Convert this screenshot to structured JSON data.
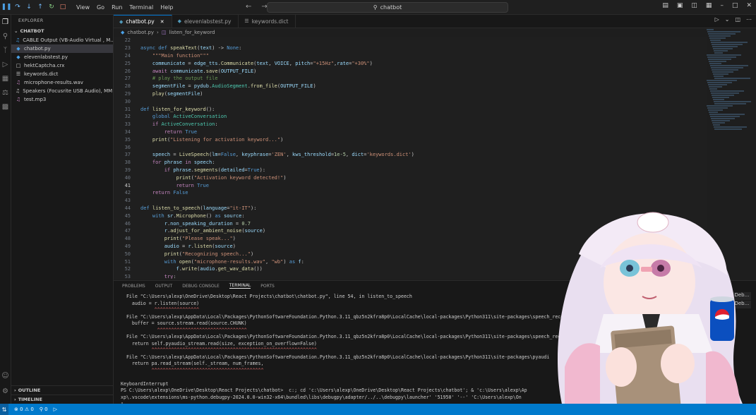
{
  "titlebar": {
    "menu": [
      "View",
      "Go",
      "Run",
      "Terminal",
      "Help"
    ],
    "search": "chatbot"
  },
  "sidebar": {
    "title": "EXPLORER",
    "section": "CHATBOT",
    "files": [
      {
        "name": "CABLE Output (VB-Audio Virtual , M...",
        "icon": "audio-file-icon"
      },
      {
        "name": "chatbot.py",
        "icon": "python-file-icon",
        "active": true
      },
      {
        "name": "elevenlabstest.py",
        "icon": "python-file-icon"
      },
      {
        "name": "hektCaptcha.crx",
        "icon": "generic-file-icon"
      },
      {
        "name": "keywords.dict",
        "icon": "generic-file-icon"
      },
      {
        "name": "microphone-results.wav",
        "icon": "audio-file-icon"
      },
      {
        "name": "Speakers (Focusrite USB Audio), MM...",
        "icon": "audio-file-icon"
      },
      {
        "name": "test.mp3",
        "icon": "audio-file-icon"
      }
    ],
    "outline": "OUTLINE",
    "timeline": "TIMELINE"
  },
  "tabs": [
    {
      "label": "chatbot.py",
      "active": true
    },
    {
      "label": "elevenlabstest.py"
    },
    {
      "label": "keywords.dict"
    }
  ],
  "breadcrumb": {
    "file": "chatbot.py",
    "symbol": "listen_for_keyword"
  },
  "editor": {
    "lines": [
      {
        "n": "22",
        "text": ""
      },
      {
        "n": "23",
        "text": "async def speakText(text) -> None:"
      },
      {
        "n": "24",
        "text": "    \"\"\"Main function\"\"\""
      },
      {
        "n": "25",
        "text": "    communicate = edge_tts.Communicate(text, VOICE, pitch=\"+15Hz\",rate=\"+30%\")"
      },
      {
        "n": "26",
        "text": "    await communicate.save(OUTPUT_FILE)"
      },
      {
        "n": "27",
        "text": "    # play the output file"
      },
      {
        "n": "28",
        "text": "    segmentFile = pydub.AudioSegment.from_file(OUTPUT_FILE)"
      },
      {
        "n": "29",
        "text": "    play(segmentFile)"
      },
      {
        "n": "30",
        "text": ""
      },
      {
        "n": "31",
        "text": "def listen_for_keyword():"
      },
      {
        "n": "32",
        "text": "    global ActiveConversation"
      },
      {
        "n": "33",
        "text": "    if ActiveConversation:"
      },
      {
        "n": "34",
        "text": "        return True"
      },
      {
        "n": "35",
        "text": "    print(\"Listening for activation keyword...\")"
      },
      {
        "n": "36",
        "text": ""
      },
      {
        "n": "37",
        "text": "    speech = LiveSpeech(lm=False, keyphrase='ZEN', kws_threshold=1e-5, dict='keywords.dict')"
      },
      {
        "n": "38",
        "text": "    for phrase in speech:"
      },
      {
        "n": "39",
        "text": "        if phrase.segments(detailed=True):"
      },
      {
        "n": "40",
        "text": "            print(\"Activation keyword detected!\")"
      },
      {
        "n": "41",
        "text": "            return True",
        "current": true
      },
      {
        "n": "42",
        "text": "    return False"
      },
      {
        "n": "43",
        "text": ""
      },
      {
        "n": "44",
        "text": "def listen_to_speech(language=\"it-IT\"):"
      },
      {
        "n": "45",
        "text": "    with sr.Microphone() as source:"
      },
      {
        "n": "46",
        "text": "        r.non_speaking_duration = 0.7"
      },
      {
        "n": "47",
        "text": "        r.adjust_for_ambient_noise(source)"
      },
      {
        "n": "48",
        "text": "        print(\"Please speak...\")"
      },
      {
        "n": "49",
        "text": "        audio = r.listen(source)"
      },
      {
        "n": "50",
        "text": "        print(\"Recognizing speech...\")"
      },
      {
        "n": "51",
        "text": "        with open(\"microphone-results.wav\", \"wb\") as f:"
      },
      {
        "n": "52",
        "text": "            f.write(audio.get_wav_data())"
      },
      {
        "n": "53",
        "text": "        try:"
      }
    ]
  },
  "panel": {
    "tabs": [
      "PROBLEMS",
      "OUTPUT",
      "DEBUG CONSOLE",
      "TERMINAL",
      "PORTS"
    ],
    "active_tab": "TERMINAL",
    "terminal": [
      "  File \"C:\\Users\\alexp\\OneDrive\\Desktop\\React Projects\\chatbot\\chatbot.py\", line 54, in listen_to_speech",
      "    audio = r.listen(source)",
      "            ^^^^^^^^^^^^^^^^",
      "  File \"C:\\Users\\alexp\\AppData\\Local\\Packages\\PythonSoftwareFoundation.Python.3.11_qbz5n2kfra8p0\\LocalCache\\local-packages\\Python311\\site-packages\\speech_recog",
      "    buffer = source.stream.read(source.CHUNK)",
      "             ^^^^^^^^^^^^^^^^^^^^^^^^^^^^^^^^",
      "  File \"C:\\Users\\alexp\\AppData\\Local\\Packages\\PythonSoftwareFoundation.Python.3.11_qbz5n2kfra8p0\\LocalCache\\local-packages\\Python311\\site-packages\\speech_reco",
      "    return self.pyaudio_stream.read(size, exception_on_overflow=False)",
      "           ^^^^^^^^^^^^^^^^^^^^^^^^^^^^^^^^^^^^^^^^^^^^^^^^^^^^^^^^^^^",
      "  File \"C:\\Users\\alexp\\AppData\\Local\\Packages\\PythonSoftwareFoundation.Python.3.11_qbz5n2kfra8p0\\LocalCache\\local-packages\\Python311\\site-packages\\pyaudi",
      "    return pa.read_stream(self._stream, num_frames,",
      "           ^^^^^^^^^^^^^^^^^^^^^^^^^^^^^^^^^^^^^^^^",
      "",
      "KeyboardInterrupt",
      "PS C:\\Users\\alexp\\OneDrive\\Desktop\\React Projects\\chatbot>  c:; cd 'c:\\Users\\alexp\\OneDrive\\Desktop\\React Projects\\chatbot'; & 'c:\\Users\\alexp\\Ap",
      "xp\\.vscode\\extensions\\ms-python.debugpy-2024.0.0-win32-x64\\bundled\\libs\\debugpy\\adapter/../..\\debugpy\\launcher' '51950' '--' 'C:\\Users\\alexp\\On",
      "▯"
    ],
    "debug_sessions": [
      "Python Deb...",
      "Python Deb..."
    ]
  },
  "statusbar": {
    "errors": "0",
    "warnings": "0",
    "ports": "0"
  },
  "colors": {
    "statusbar": "#007acc",
    "keyword": "#569cd6",
    "control": "#c586c0",
    "string": "#ce9178",
    "function": "#dcdcaa",
    "variable": "#9cdcfe",
    "number": "#b5cea8",
    "comment": "#6a9955"
  }
}
